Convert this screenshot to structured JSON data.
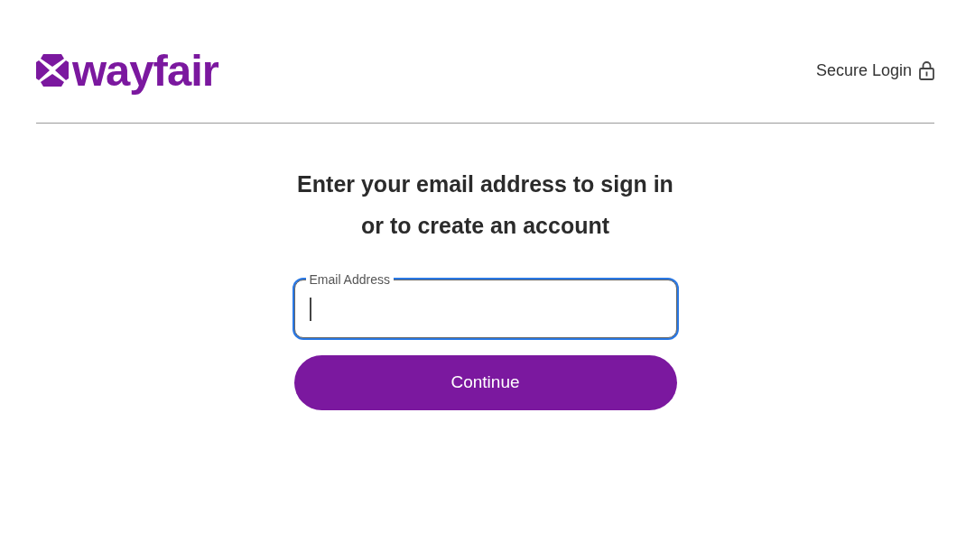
{
  "header": {
    "logo": {
      "text": "wayfair"
    },
    "secure_login": {
      "label": "Secure Login"
    }
  },
  "heading": "Enter your email address to sign in or to create an account",
  "email_field": {
    "label": "Email Address",
    "focused": true
  },
  "continue_button": {
    "label": "Continue"
  }
}
